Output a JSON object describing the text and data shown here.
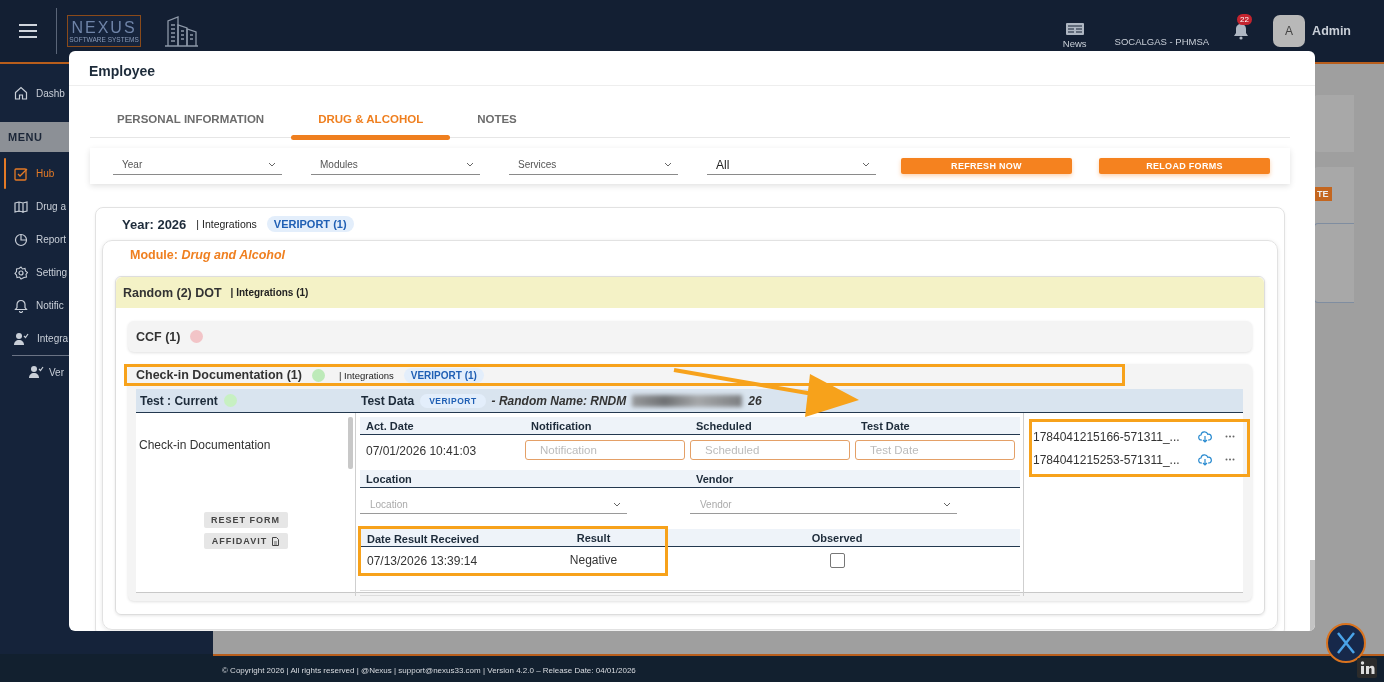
{
  "topbar": {
    "logo": {
      "name": "NEXUS",
      "tagline": "SOFTWARE SYSTEMS"
    },
    "news": "News",
    "company": "SOCALGAS - PHMSA",
    "notifications": "22",
    "avatar": "A",
    "user": "Admin"
  },
  "sidebar": {
    "items": [
      {
        "kind": "item",
        "label": "Dashb",
        "selected": false
      },
      {
        "kind": "heading",
        "label": "MENU"
      },
      {
        "kind": "item",
        "label": "Hub",
        "selected": true
      },
      {
        "kind": "item",
        "label": "Drug a",
        "selected": false
      },
      {
        "kind": "item",
        "label": "Report",
        "selected": false
      },
      {
        "kind": "item",
        "label": "Setting",
        "selected": false
      },
      {
        "kind": "item",
        "label": "Notific",
        "selected": false
      },
      {
        "kind": "item",
        "label": "Integra",
        "selected": false,
        "children": [
          {
            "label": "Ver",
            "selected": false
          }
        ]
      }
    ]
  },
  "background": {
    "badge": "TE"
  },
  "modal": {
    "title": "Employee",
    "tabs": [
      {
        "label": "PERSONAL INFORMATION",
        "selected": false
      },
      {
        "label": "DRUG & ALCOHOL",
        "selected": true
      },
      {
        "label": "NOTES",
        "selected": false
      }
    ],
    "filters": [
      {
        "placeholder": "Year"
      },
      {
        "placeholder": "Modules"
      },
      {
        "placeholder": "Services"
      },
      {
        "value": "All"
      }
    ],
    "buttons": [
      "REFRESH NOW",
      "RELOAD FORMS"
    ],
    "year": {
      "title": "Year: 2026",
      "integrations": "| Integrations",
      "badge": "VERIPORT (1)"
    },
    "module": {
      "title": "Module: *Drug and Alcohol*"
    },
    "group": {
      "title": "Random (2) DOT",
      "integrations": "| Integrations (1)"
    },
    "forms": [
      {
        "title": "CCF (1)",
        "color": "#f2c4c7",
        "expanded": false,
        "highlighted": false
      },
      {
        "title": "Check-in Documentation (1)",
        "color": "#bdeab9",
        "expanded": true,
        "highlighted": true,
        "integrations": "| Integrations",
        "badge": "VERIPORT (1)"
      }
    ],
    "test": {
      "title": "Test : Current",
      "color": "#c7f0c2",
      "data_title": "Test Data",
      "data_badge": "VERIPORT",
      "random_name": "- Random Name: RNDM",
      "random_name_end": "26",
      "form_name": "Check-in Documentation",
      "buttons": [
        {
          "label": "RESET FORM",
          "kind": "plain"
        },
        {
          "label": "AFFIDAVIT",
          "kind": "document"
        }
      ],
      "field_rows": [
        {
          "fields": [
            {
              "kind": "text",
              "label": "Act. Date",
              "value": "07/01/2026 10:41:03"
            },
            {
              "kind": "input",
              "label": "Notification",
              "placeholder": "Notification"
            },
            {
              "kind": "input",
              "label": "Scheduled",
              "placeholder": "Scheduled"
            },
            {
              "kind": "input",
              "label": "Test Date",
              "placeholder": "Test Date"
            }
          ]
        },
        {
          "fields": [
            {
              "kind": "select",
              "label": "Location",
              "placeholder": "Location"
            },
            {
              "kind": "select",
              "label": "Vendor",
              "placeholder": "Vendor"
            }
          ]
        },
        {
          "fields": [
            {
              "kind": "text",
              "label": "Date Result Received",
              "value": "07/13/2026 13:39:14",
              "highlighted": true
            },
            {
              "kind": "text",
              "label": "Result",
              "value": "Negative",
              "highlighted": true
            },
            {
              "kind": "checkbox",
              "label": "Observed",
              "checked": false,
              "highlighted": false
            }
          ]
        }
      ],
      "files": {
        "highlighted": true,
        "items": [
          {
            "name": "1784041215166-571311_..."
          },
          {
            "name": "1784041215253-571311_..."
          }
        ]
      }
    }
  },
  "footer": {
    "text": "© Copyright 2026 | All rights reserved | @Nexus | support@nexus33.com | Version 4.2.0 – Release Date: 04/01/2026"
  }
}
